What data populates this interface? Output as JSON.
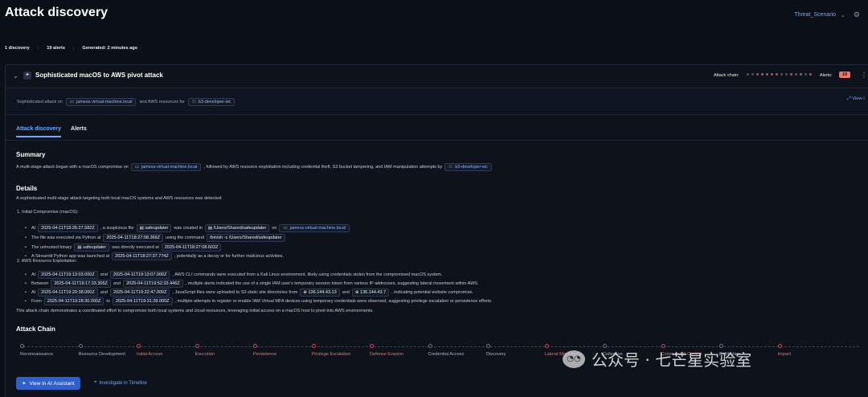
{
  "header": {
    "title": "Attack discovery",
    "scenario": "Threat_Scenario"
  },
  "stats": {
    "discoveries": "1 discovery",
    "alerts": "19 alerts",
    "generated": "Generated: 2 minutes ago"
  },
  "discovery": {
    "title": "Sophisticated macOS to AWS pivot attack",
    "chain_label": "Attack chain:",
    "alerts_label": "Alerts:",
    "alerts_count": "19",
    "subtitle_a": "Sophisticated attack on",
    "host": "jamess-virtual-machine.local",
    "subtitle_b": "and AWS resources for",
    "user": "b3-developer-wc",
    "view_link": "View i"
  },
  "tabs": [
    "Attack discovery",
    "Alerts"
  ],
  "summary": {
    "heading": "Summary",
    "a": "A multi-stage attack began with a macOS compromise on",
    "host": "jamess-virtual-machine.local",
    "b": ", followed by AWS resource exploitation including credential theft, S3 bucket tampering, and IAM manipulation attempts by",
    "user": "b3-developer-wc"
  },
  "details": {
    "heading": "Details",
    "intro": "A sophisticated multi-stage attack targeting both local macOS systems and AWS resources was detected:",
    "s1": "1. Initial Compromise (macOS):",
    "s1_b1": [
      "At",
      "2025-04-11T18:26:27.582Z",
      ", a suspicious file",
      "safeupdater",
      "was created in",
      "/Users/Shared/safeupdater",
      "on",
      "jamess-virtual-machine.local"
    ],
    "s1_b2": [
      "The file was executed via Python at",
      "2025-04-11T18:27:08.366Z",
      "using the command",
      "/bin/sh -c /Users/Shared/safeupdater"
    ],
    "s1_b3": [
      "The untrusted binary",
      "safeupdater",
      "was directly executed at",
      "2025-04-11T18:27:08.603Z"
    ],
    "s1_b4": [
      "A Streamlit Python app was launched at",
      "2025-04-11T18:27:37.774Z",
      ", potentially as a decoy or for further malicious activities."
    ],
    "s2": "2. AWS Resource Exploitation:",
    "s2_b1": [
      "At",
      "2025-04-11T19:13:03.000Z",
      "and",
      "2025-04-11T19:13:07.000Z",
      ", AWS CLI commands were executed from a Kali Linux environment, likely using credentials stolen from the compromised macOS system."
    ],
    "s2_b2": [
      "Between",
      "2025-04-11T19:17:33.305Z",
      "and",
      "2025-04-11T19:52:33.446Z",
      ", multiple alerts indicated the use of a single IAM user's temporary session token from various IP addresses, suggesting lateral movement within AWS."
    ],
    "s2_b3": [
      "At",
      "2025-04-11T19:20:38.000Z",
      "and",
      "2025-04-11T19:22:47.000Z",
      ", JavaScript files were uploaded to S3 static site directories from",
      "136.144.43.13",
      "and",
      "136.144.43.7",
      ", indicating potential website compromise."
    ],
    "s2_b4": [
      "From",
      "2025-04-11T19:28:30.000Z",
      "to",
      "2025-04-11T19:31:28.000Z",
      ", multiple attempts to register or enable IAM Virtual MFA devices using temporary credentials were observed, suggesting privilege escalation or persistence efforts."
    ],
    "outro": "This attack chain demonstrates a coordinated effort to compromise both local systems and cloud resources, leveraging initial access on a macOS host to pivot into AWS environments."
  },
  "attack_chain": {
    "heading": "Attack Chain",
    "stages": [
      {
        "label": "Reconnaissance",
        "hit": false
      },
      {
        "label": "Resource Development",
        "hit": false
      },
      {
        "label": "Initial Access",
        "hit": true
      },
      {
        "label": "Execution",
        "hit": true
      },
      {
        "label": "Persistence",
        "hit": true
      },
      {
        "label": "Privilege Escalation",
        "hit": true
      },
      {
        "label": "Defense Evasion",
        "hit": true
      },
      {
        "label": "Credential Access",
        "hit": false
      },
      {
        "label": "Discovery",
        "hit": false
      },
      {
        "label": "Lateral Movement",
        "hit": true
      },
      {
        "label": "Collection",
        "hit": false
      },
      {
        "label": "Command & Control",
        "hit": true
      },
      {
        "label": "Exfiltration",
        "hit": false
      },
      {
        "label": "Impact",
        "hit": true
      }
    ]
  },
  "actions": {
    "ai_button": "View in AI Assistant",
    "timeline_link": "Investigate in Timeline"
  },
  "watermark": "公众号 · 七芒星实验室"
}
